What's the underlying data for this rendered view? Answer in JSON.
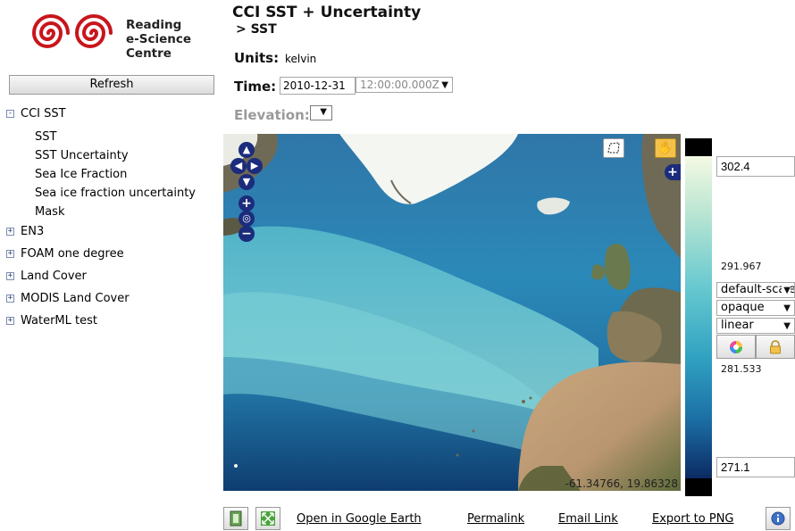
{
  "logo": {
    "line1": "Reading",
    "line2": "e-Science",
    "line3": "Centre"
  },
  "sidebar": {
    "refresh_label": "Refresh",
    "tree": [
      {
        "label": "CCI SST",
        "toggle": "-",
        "children": [
          "SST",
          "SST Uncertainty",
          "Sea Ice Fraction",
          "Sea ice fraction uncertainty",
          "Mask"
        ]
      },
      {
        "label": "EN3",
        "toggle": "+"
      },
      {
        "label": "FOAM one degree",
        "toggle": "+"
      },
      {
        "label": "Land Cover",
        "toggle": "+"
      },
      {
        "label": "MODIS Land Cover",
        "toggle": "+"
      },
      {
        "label": "WaterML test",
        "toggle": "+"
      }
    ]
  },
  "header": {
    "title": "CCI SST + Uncertainty",
    "subtitle": "> SST",
    "units_label": "Units:",
    "units_value": "kelvin",
    "time_label": "Time:",
    "date_value": "2010-12-31",
    "time_value": "12:00:00.000Z",
    "elevation_label": "Elevation:"
  },
  "map": {
    "coordinates": "-61.34766, 19.86328"
  },
  "scale": {
    "max": "302.4",
    "upper_tick": "291.967",
    "lower_tick": "281.533",
    "min": "271.1",
    "palette": "default-scale",
    "opacity": "opaque",
    "scaling": "linear"
  },
  "footer": {
    "google_earth": "Open in Google Earth",
    "permalink": "Permalink",
    "email": "Email Link",
    "export": "Export to PNG"
  },
  "colors": {
    "nav": "#1b2c7c",
    "land": "#6f6a56",
    "ice": "#f4f6f2"
  }
}
